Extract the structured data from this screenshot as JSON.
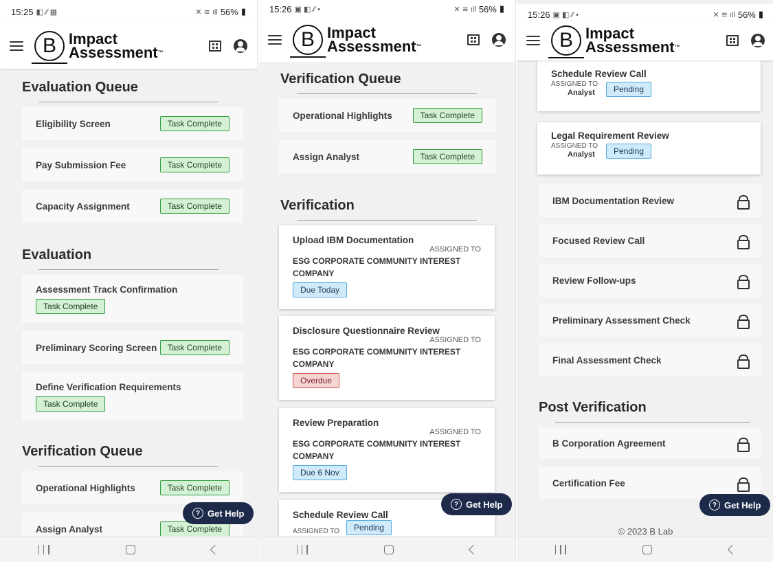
{
  "screens": [
    {
      "status": {
        "time": "15:25",
        "battery": "56%"
      },
      "app": {
        "title_line1": "Impact",
        "title_line2": "Assessment",
        "tm": "™",
        "logo_letter": "B"
      },
      "sections": [
        {
          "title": "Evaluation Queue"
        },
        {
          "title": "Evaluation"
        },
        {
          "title": "Verification Queue"
        }
      ],
      "rows": [
        {
          "label": "Eligibility Screen",
          "badge": "Task Complete"
        },
        {
          "label": "Pay Submission Fee",
          "badge": "Task Complete"
        },
        {
          "label": "Capacity Assignment",
          "badge": "Task Complete"
        },
        {
          "label": "Assessment Track Confirmation",
          "badge": "Task Complete"
        },
        {
          "label": "Preliminary Scoring Screen",
          "badge": "Task Complete"
        },
        {
          "label": "Define Verification Requirements",
          "badge": "Task Complete"
        },
        {
          "label": "Operational Highlights",
          "badge": "Task Complete"
        },
        {
          "label": "Assign Analyst",
          "badge": "Task Complete"
        }
      ],
      "help": {
        "label": "Get Help",
        "icon": "?"
      }
    },
    {
      "status": {
        "time": "15:26",
        "battery": "56%"
      },
      "app": {
        "title_line1": "Impact",
        "title_line2": "Assessment",
        "tm": "™",
        "logo_letter": "B"
      },
      "sections": [
        {
          "title": "Verification Queue"
        },
        {
          "title": "Verification"
        }
      ],
      "rows": [
        {
          "label": "Operational Highlights",
          "badge": "Task Complete"
        },
        {
          "label": "Assign Analyst",
          "badge": "Task Complete"
        }
      ],
      "cards": [
        {
          "title": "Upload IBM Documentation",
          "assigned": "ASSIGNED TO",
          "company": "ESG CORPORATE COMMUNITY INTEREST COMPANY",
          "badge": "Due Today"
        },
        {
          "title": "Disclosure Questionnaire Review",
          "assigned": "ASSIGNED TO",
          "company": "ESG CORPORATE COMMUNITY INTEREST COMPANY",
          "badge": "Overdue"
        },
        {
          "title": "Review Preparation",
          "assigned": "ASSIGNED TO",
          "company": "ESG CORPORATE COMMUNITY INTEREST COMPANY",
          "badge": "Due 6 Nov"
        },
        {
          "title": "Schedule Review Call",
          "assigned": "ASSIGNED TO",
          "badge": "Pending"
        }
      ],
      "help": {
        "label": "Get Help",
        "icon": "?"
      }
    },
    {
      "status": {
        "time": "15:26",
        "battery": "56%"
      },
      "app": {
        "title_line1": "Impact",
        "title_line2": "Assessment",
        "tm": "™",
        "logo_letter": "B"
      },
      "cards": [
        {
          "title": "Schedule Review Call",
          "assigned": "ASSIGNED TO",
          "assignee": "Analyst",
          "badge": "Pending"
        },
        {
          "title": "Legal Requirement Review",
          "assigned": "ASSIGNED TO",
          "assignee": "Analyst",
          "badge": "Pending"
        }
      ],
      "locked_rows": [
        {
          "label": "IBM Documentation Review"
        },
        {
          "label": "Focused Review Call"
        },
        {
          "label": "Review Follow-ups"
        },
        {
          "label": "Preliminary Assessment Check"
        },
        {
          "label": "Final Assessment Check"
        }
      ],
      "sections": [
        {
          "title": "Post Verification"
        }
      ],
      "post_rows": [
        {
          "label": "B Corporation Agreement"
        },
        {
          "label": "Certification Fee"
        }
      ],
      "help": {
        "label": "Get Help",
        "icon": "?"
      },
      "footer": "© 2023 B Lab"
    }
  ],
  "colors": {
    "complete_bg": "#d5f1d5",
    "pending_bg": "#cfeaf8",
    "overdue_bg": "#f7d4d4",
    "help_bg": "#1d2a4a"
  }
}
